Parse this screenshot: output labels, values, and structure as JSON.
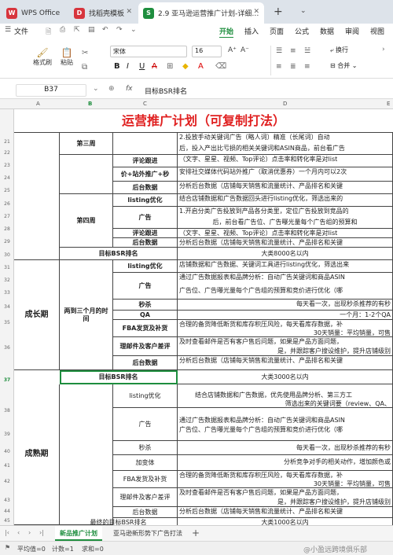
{
  "tabs": [
    {
      "label": "WPS Office",
      "icon": "W",
      "color": "#d7353d"
    },
    {
      "label": "找稻壳模板",
      "icon": "D",
      "color": "#d7353d"
    },
    {
      "label": "2.9 亚马逊运营推广计划-详细…",
      "icon": "S",
      "color": "#1e8e3e"
    }
  ],
  "menu": {
    "file": "文件",
    "items": [
      "开始",
      "插入",
      "页面",
      "公式",
      "数据",
      "审阅",
      "视图"
    ]
  },
  "toolbar": {
    "brush": "格式刷",
    "paste": "粘贴",
    "font": "宋体",
    "size": "16",
    "wrap": "换行",
    "merge": "合并"
  },
  "formula": {
    "cell": "B37",
    "fx": "fx",
    "value": "目标BSR排名"
  },
  "columns": [
    "A",
    "B",
    "C",
    "D",
    "E"
  ],
  "title": "运营推广计划（可复制打法）",
  "rows": [
    "21",
    "22",
    "23",
    "24",
    "25",
    "26",
    "27",
    "28",
    "29",
    "30",
    "31",
    "32",
    "33",
    "34",
    "35",
    "36",
    "37",
    "38",
    "39",
    "40",
    "41",
    "42",
    "43",
    "44",
    "45"
  ],
  "grid": {
    "week3": "第三周",
    "r21": "2.投放手动关键词广告（略人词）精准（长尾词）自动",
    "r22": "后，投入产出比亏损的相关关键词和ASIN商品，前台看广告",
    "r23b": "评论跟进",
    "r23c": "（文字、星星、视频、Top评论）点击率和转化率是对list",
    "r24b": "价+站外推广+秒",
    "r24c": "安排社交媒体代码站外推广（取消优惠券）一个月内可以2次",
    "r25b": "后台数据",
    "r25c": "分析后台数据（店铺每天销售和流量统计、产品排名和关键",
    "week4": "第四周",
    "r26b": "listing优化",
    "r26c": "结合店铺数据和广告数据回头进行listing优化，筛选出来的",
    "r27b": "广告",
    "r27c": "1.开启分类广告投放到产品各分类里，定位广告投放到竞品的",
    "r28c": "后，前台看广告位、广告曝光量每个广告组的预算和",
    "r29b": "评论跟进",
    "r29c": "（文字、星星、视频、Top评论）点击率和转化率是对list",
    "r30b": "后台数据",
    "r30c": "分析后台数据（店铺每天销售和流量统计、产品排名和关键",
    "r31a": "目标BSR排名",
    "r31c": "大类8000名以内",
    "growth": "成长期",
    "growthPeriod": "两到三个月的时间",
    "r32b": "listing优化",
    "r32c": "店铺数据和广告数据、关键词工具进行listing优化，筛选出来",
    "r33b": "广告",
    "r33c": "通过广告数据报表和品牌分析：自动广告关键词和商品ASIN",
    "r33d": "广告位、广告曝光量每个广告组的预算和竞价进行优化（哪",
    "r34b": "秒杀",
    "r34c": "每天看一次，出现秒杀推荐的有秒",
    "r35b": "QA",
    "r35c": "一个月：1-2个QA",
    "r36b": "FBA发货及补货",
    "r36c": "合理的备货降低断货和库存积压风险，每天看库存数据，补",
    "r36d": "30天销量：平均销量，可售",
    "r37b": "理邮件及客户差评",
    "r37c": "及时查看邮件是否有客户售后问题，如果是产品方面问题，",
    "r37d": "是，并跟踪客户搜设维护，提升店铺级别",
    "r38b": "后台数据",
    "r38c": "分析后台数据（店铺每天销售和流量统计、产品排名和关键",
    "r39a": "目标BSR排名",
    "r39c": "大类3000名以内",
    "mature": "成熟期",
    "r40b": "listing优化",
    "r40c": "结合店铺数据和广告数据，优先使用品牌分析、第三方工",
    "r40d": "筛选出来的关键词要（review、QA、",
    "r41b": "广告",
    "r41c": "通过广告数据报表和品牌分析：自动广告关键词和商品ASIN",
    "r41d": "广告位、广告曝光量每个广告组的预算和竞价进行优化（哪",
    "r42b": "秒杀",
    "r42c": "每天看一次，出现秒杀推荐的有秒",
    "r43b": "加变体",
    "r43c": "分析竞争对手的相关动作，增加颜色或",
    "r44b": "FBA发货及补货",
    "r44c": "合理的备货降低断货和库存积压风险，每天看库存数据，补",
    "r44d": "30天销量：平均销量，可售",
    "r45b": "理邮件及客户差评",
    "r45c": "及时查看邮件是否有客户售后问题，如果是产品方面问题，",
    "r45d": "是，并跟踪客户搜设维护，提升店铺级别",
    "r46b": "后台数据",
    "r46c": "分析后台数据（店铺每天销售和流量统计、产品排名和关键",
    "r47a": "最终的目标BSR排名",
    "r47c": "大类1000名以内"
  },
  "sheets": [
    "新品推广计划",
    "亚马逊新形势下广告打法"
  ],
  "status": {
    "avg": "平均值=0",
    "count": "计数=1",
    "sum": "求和=0"
  },
  "watermark": "@小盈远跨境俱乐部",
  "accent": "#1e8e3e",
  "titleColor": "#e02020"
}
